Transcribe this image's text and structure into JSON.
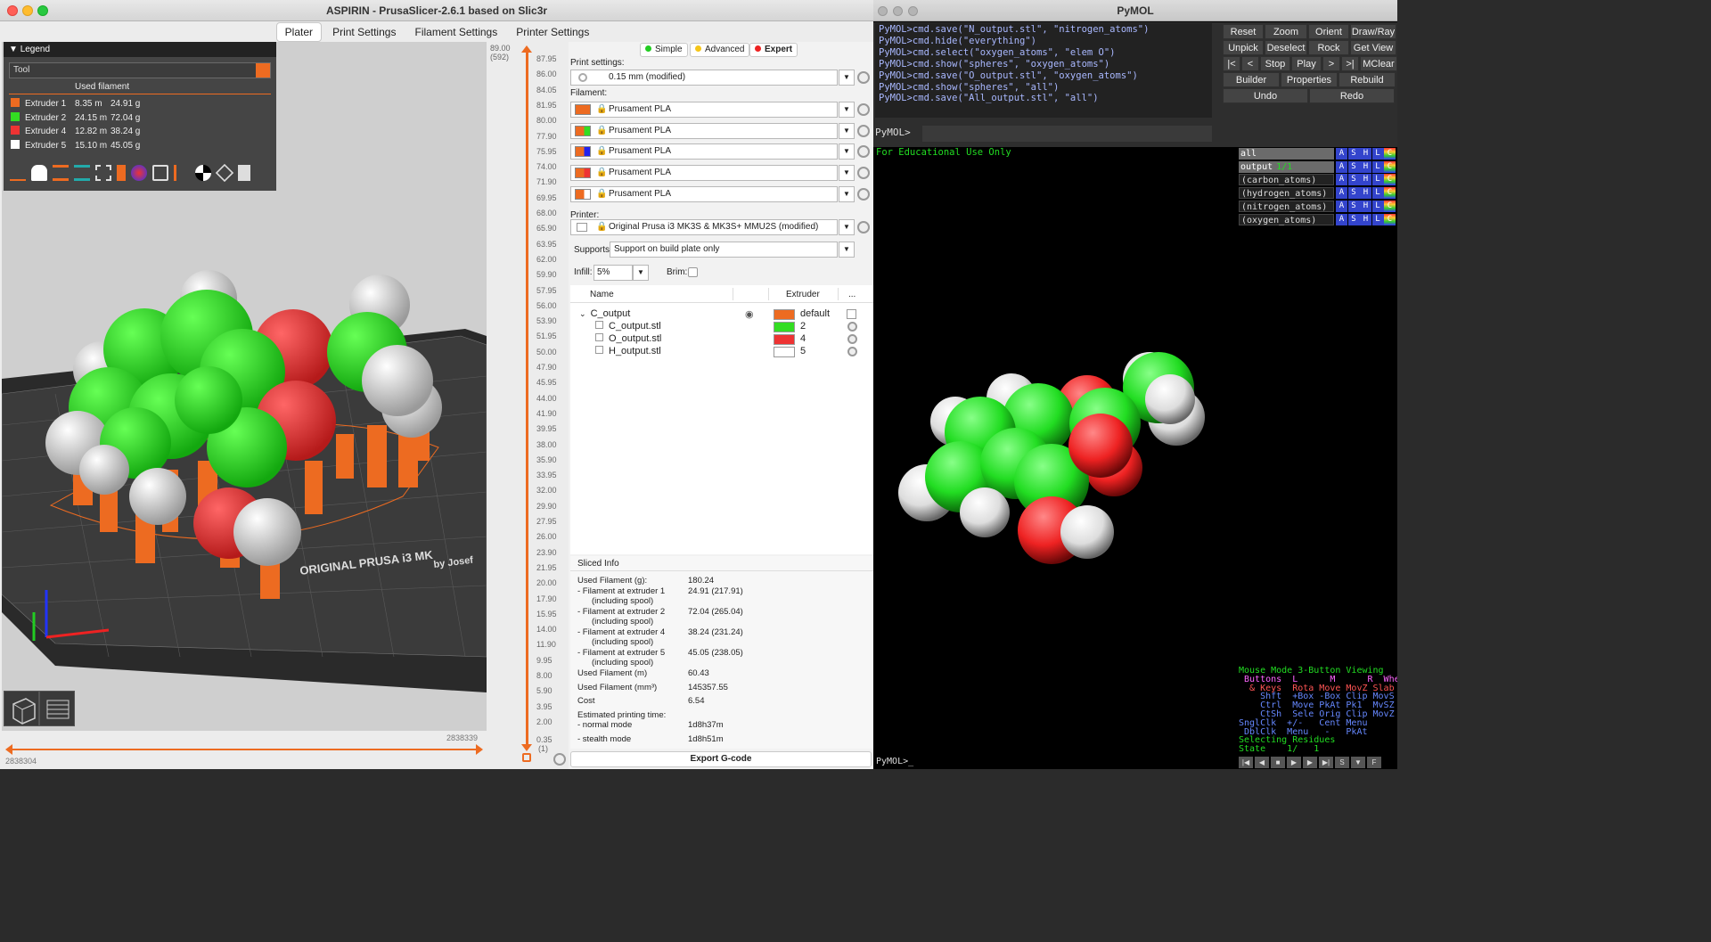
{
  "prusa": {
    "title": "ASPIRIN - PrusaSlicer-2.6.1 based on Slic3r",
    "tabs": [
      "Plater",
      "Print Settings",
      "Filament Settings",
      "Printer Settings"
    ],
    "legend": {
      "header": "Legend",
      "view_type": "Tool",
      "subheader": "Used filament",
      "rows": [
        {
          "name": "Extruder 1",
          "length": "8.35 m",
          "weight": "24.91 g",
          "color": "#ed6b21"
        },
        {
          "name": "Extruder 2",
          "length": "24.15 m",
          "weight": "72.04 g",
          "color": "#33dd22"
        },
        {
          "name": "Extruder 4",
          "length": "12.82 m",
          "weight": "38.24 g",
          "color": "#ee3333"
        },
        {
          "name": "Extruder 5",
          "length": "15.10 m",
          "weight": "45.05 g",
          "color": "#ffffff"
        }
      ]
    },
    "bed_text_1": "ORIGINAL PRUSA i3 MK",
    "bed_text_2": "by Josef",
    "hslider": {
      "right_value": "2838339",
      "left_value": "2838304"
    },
    "vslider": {
      "top_value": "89.00",
      "top_sub": "(592)",
      "bottom_value": "0.35",
      "bottom_sub": "(1)",
      "ticks": [
        "87.95",
        "86.00",
        "84.05",
        "81.95",
        "80.00",
        "77.90",
        "75.95",
        "74.00",
        "71.90",
        "69.95",
        "68.00",
        "65.90",
        "63.95",
        "62.00",
        "59.90",
        "57.95",
        "56.00",
        "53.90",
        "51.95",
        "50.00",
        "47.90",
        "45.95",
        "44.00",
        "41.90",
        "39.95",
        "38.00",
        "35.90",
        "33.95",
        "32.00",
        "29.90",
        "27.95",
        "26.00",
        "23.90",
        "21.95",
        "20.00",
        "17.90",
        "15.95",
        "14.00",
        "11.90",
        "9.95",
        "8.00",
        "5.90",
        "3.95",
        "2.00"
      ]
    },
    "modes": {
      "simple": "Simple",
      "advanced": "Advanced",
      "expert": "Expert"
    },
    "print_settings_label": "Print settings:",
    "print_settings_value": "0.15 mm (modified)",
    "filament_label": "Filament:",
    "filaments": [
      {
        "name": "Prusament PLA",
        "c1": "#ed6b21",
        "c2": "#ed6b21"
      },
      {
        "name": "Prusament PLA",
        "c1": "#ed6b21",
        "c2": "#33dd22"
      },
      {
        "name": "Prusament PLA",
        "c1": "#ed6b21",
        "c2": "#2222ee"
      },
      {
        "name": "Prusament PLA",
        "c1": "#ed6b21",
        "c2": "#ee3333"
      },
      {
        "name": "Prusament PLA",
        "c1": "#ed6b21",
        "c2": "#ffffff"
      }
    ],
    "printer_label": "Printer:",
    "printer_value": "Original Prusa i3 MK3S & MK3S+ MMU2S (modified)",
    "supports_label": "Supports:",
    "supports_value": "Support on build plate only",
    "infill_label": "Infill:",
    "infill_value": "5%",
    "brim_label": "Brim:",
    "objlist": {
      "col_name": "Name",
      "col_extruder": "Extruder",
      "col_more": "...",
      "object": {
        "name": "C_output",
        "extruder": "default",
        "color": "#ed6b21"
      },
      "parts": [
        {
          "name": "C_output.stl",
          "extruder": "2",
          "color": "#33dd22"
        },
        {
          "name": "O_output.stl",
          "extruder": "4",
          "color": "#ee3333"
        },
        {
          "name": "H_output.stl",
          "extruder": "5",
          "color": "#ffffff"
        }
      ]
    },
    "sliced": {
      "title": "Sliced Info",
      "rows": [
        {
          "label": "Used Filament (g):",
          "value": "180.24"
        },
        {
          "label": "- Filament at extruder 1",
          "label2": "(including spool)",
          "value": "24.91 (217.91)"
        },
        {
          "label": "- Filament at extruder 2",
          "label2": "(including spool)",
          "value": "72.04 (265.04)"
        },
        {
          "label": "- Filament at extruder 4",
          "label2": "(including spool)",
          "value": "38.24 (231.24)"
        },
        {
          "label": "- Filament at extruder 5",
          "label2": "(including spool)",
          "value": "45.05 (238.05)"
        },
        {
          "label": "Used Filament (m)",
          "value": "60.43"
        },
        {
          "label": "Used Filament (mm³)",
          "value": "145357.55"
        },
        {
          "label": "Cost",
          "value": "6.54"
        },
        {
          "label": "Estimated printing time:",
          "value": ""
        },
        {
          "label": "- normal mode",
          "value": "1d8h37m"
        },
        {
          "label": "- stealth mode",
          "value": "1d8h51m"
        }
      ]
    },
    "export_label": "Export G-code"
  },
  "pymol": {
    "title": "PyMOL",
    "log": [
      "PyMOL>cmd.save(\"N_output.stl\", \"nitrogen_atoms\")",
      "PyMOL>cmd.hide(\"everything\")",
      "PyMOL>cmd.select(\"oxygen_atoms\", \"elem O\")",
      "PyMOL>cmd.show(\"spheres\", \"oxygen_atoms\")",
      "PyMOL>cmd.save(\"O_output.stl\", \"oxygen_atoms\")",
      "PyMOL>cmd.show(\"spheres\", \"all\")",
      "PyMOL>cmd.save(\"All_output.stl\", \"all\")"
    ],
    "prompt": "PyMOL>",
    "buttons": {
      "row1": [
        "Reset",
        "Zoom",
        "Orient",
        "Draw/Ray"
      ],
      "row2": [
        "Unpick",
        "Deselect",
        "Rock",
        "Get View"
      ],
      "row3": [
        "|<",
        "<",
        "Stop",
        "Play",
        ">",
        ">|",
        "MClear"
      ],
      "row4": [
        "Builder",
        "Properties",
        "Rebuild"
      ],
      "row5": [
        "Undo",
        "Redo"
      ]
    },
    "edu_text": "For Educational Use Only",
    "objects": [
      {
        "name": "all",
        "extra": ""
      },
      {
        "name": "output",
        "extra": "1/1"
      },
      {
        "name": "(carbon_atoms)",
        "extra": ""
      },
      {
        "name": "(hydrogen_atoms)",
        "extra": ""
      },
      {
        "name": "(nitrogen_atoms)",
        "extra": ""
      },
      {
        "name": "(oxygen_atoms)",
        "extra": ""
      }
    ],
    "asc_buttons": [
      "A",
      "S",
      "H",
      "L",
      "C"
    ],
    "mouse_mode": [
      {
        "text": "Mouse Mode 3-Button Viewing",
        "color": "#22dd22"
      },
      {
        "text": " Buttons  L      M      R  Wheel",
        "color": "#ff66ff"
      },
      {
        "text": "  & Keys  Rota Move MovZ Slab",
        "color": "#ff5555"
      },
      {
        "text": "    Shft  +Box -Box Clip MovS",
        "color": "#6688ff"
      },
      {
        "text": "    Ctrl  Move PkAt Pk1  MvSZ",
        "color": "#6688ff"
      },
      {
        "text": "    CtSh  Sele Orig Clip MovZ",
        "color": "#6688ff"
      },
      {
        "text": "SnglClk  +/-   Cent Menu",
        "color": "#6688ff"
      },
      {
        "text": " DblClk  Menu   -   PkAt",
        "color": "#6688ff"
      },
      {
        "text": "Selecting Residues",
        "color": "#22dd22"
      },
      {
        "text": "State    1/   1",
        "color": "#22dd22"
      }
    ],
    "bottom_prompt": "PyMOL>_"
  }
}
